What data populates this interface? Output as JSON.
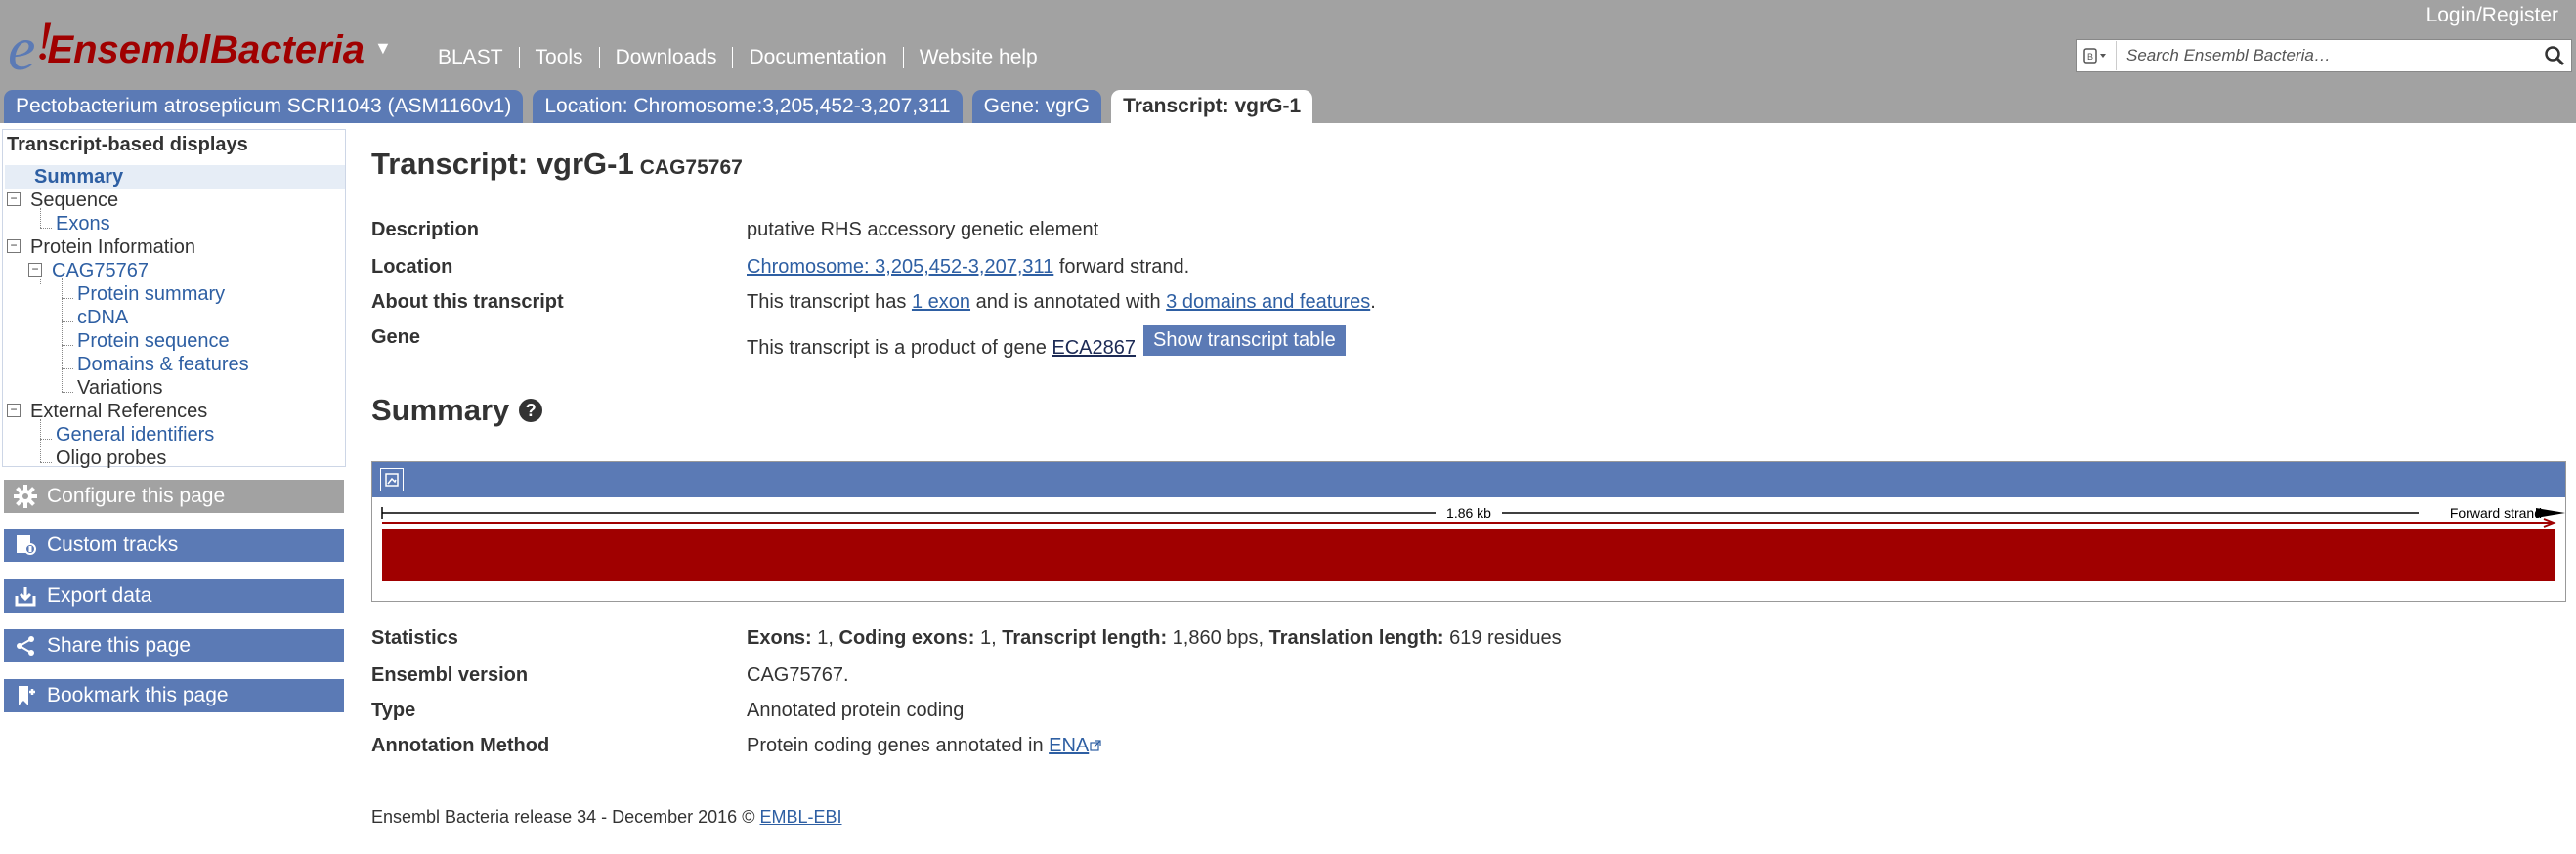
{
  "header": {
    "logo_e": "e",
    "logo_bang": "!",
    "brand": "EnsemblBacteria",
    "caret": "▼",
    "nav": [
      "BLAST",
      "Tools",
      "Downloads",
      "Documentation",
      "Website help"
    ],
    "login": "Login/Register",
    "search_placeholder": "Search Ensembl Bacteria…"
  },
  "tabs": [
    {
      "label": "Pectobacterium atrosepticum SCRI1043 (ASM1160v1)",
      "active": false
    },
    {
      "label": "Location: Chromosome:3,205,452-3,207,311",
      "active": false
    },
    {
      "label": "Gene: vgrG",
      "active": false
    },
    {
      "label": "Transcript: vgrG-1",
      "active": true
    }
  ],
  "sidebar": {
    "heading": "Transcript-based displays",
    "items": {
      "summary": "Summary",
      "sequence": "Sequence",
      "exons": "Exons",
      "protein_information": "Protein Information",
      "cag": "CAG75767",
      "protein_summary": "Protein summary",
      "cdna": "cDNA",
      "protein_sequence": "Protein sequence",
      "domains": "Domains & features",
      "variations": "Variations",
      "external_references": "External References",
      "general_identifiers": "General identifiers",
      "oligo_probes": "Oligo probes"
    },
    "tools": {
      "configure": "Configure this page",
      "custom_tracks": "Custom tracks",
      "export": "Export data",
      "share": "Share this page",
      "bookmark": "Bookmark this page"
    }
  },
  "main": {
    "title": "Transcript: vgrG-1",
    "title_id": "CAG75767",
    "description_label": "Description",
    "description": "putative RHS accessory genetic element",
    "location_label": "Location",
    "location_link": "Chromosome: 3,205,452-3,207,311",
    "location_suffix": "forward strand.",
    "about_label": "About this transcript",
    "about_pre": "This transcript has",
    "about_exon_link": "1 exon",
    "about_mid": "and is annotated with",
    "about_domains_link": "3 domains and features",
    "about_end": ".",
    "gene_label": "Gene",
    "gene_pre": "This transcript is a product of gene",
    "gene_link": "ECA2867",
    "show_table": "Show transcript table",
    "summary_heading": "Summary",
    "help": "?",
    "track": {
      "length_label": "1.86 kb",
      "strand_label": "Forward strand",
      "transcript_color": "#a00000"
    },
    "stats_label": "Statistics",
    "stats": {
      "exons_k": "Exons:",
      "exons_v": "1,",
      "coding_k": "Coding exons:",
      "coding_v": "1,",
      "tlen_k": "Transcript length:",
      "tlen_v": "1,860 bps,",
      "trans_k": "Translation length:",
      "trans_v": "619 residues"
    },
    "version_label": "Ensembl version",
    "version": "CAG75767.",
    "type_label": "Type",
    "type": "Annotated protein coding",
    "method_label": "Annotation Method",
    "method_pre": "Protein coding genes annotated in",
    "method_link": "ENA"
  },
  "footer": {
    "text": "Ensembl Bacteria release 34 - December 2016 ©",
    "link": "EMBL-EBI"
  },
  "colors": {
    "header_bg": "#a2a2a2",
    "tab_bg": "#5b7ab5",
    "brand_red": "#a00000",
    "link_blue": "#2e5fa3"
  }
}
